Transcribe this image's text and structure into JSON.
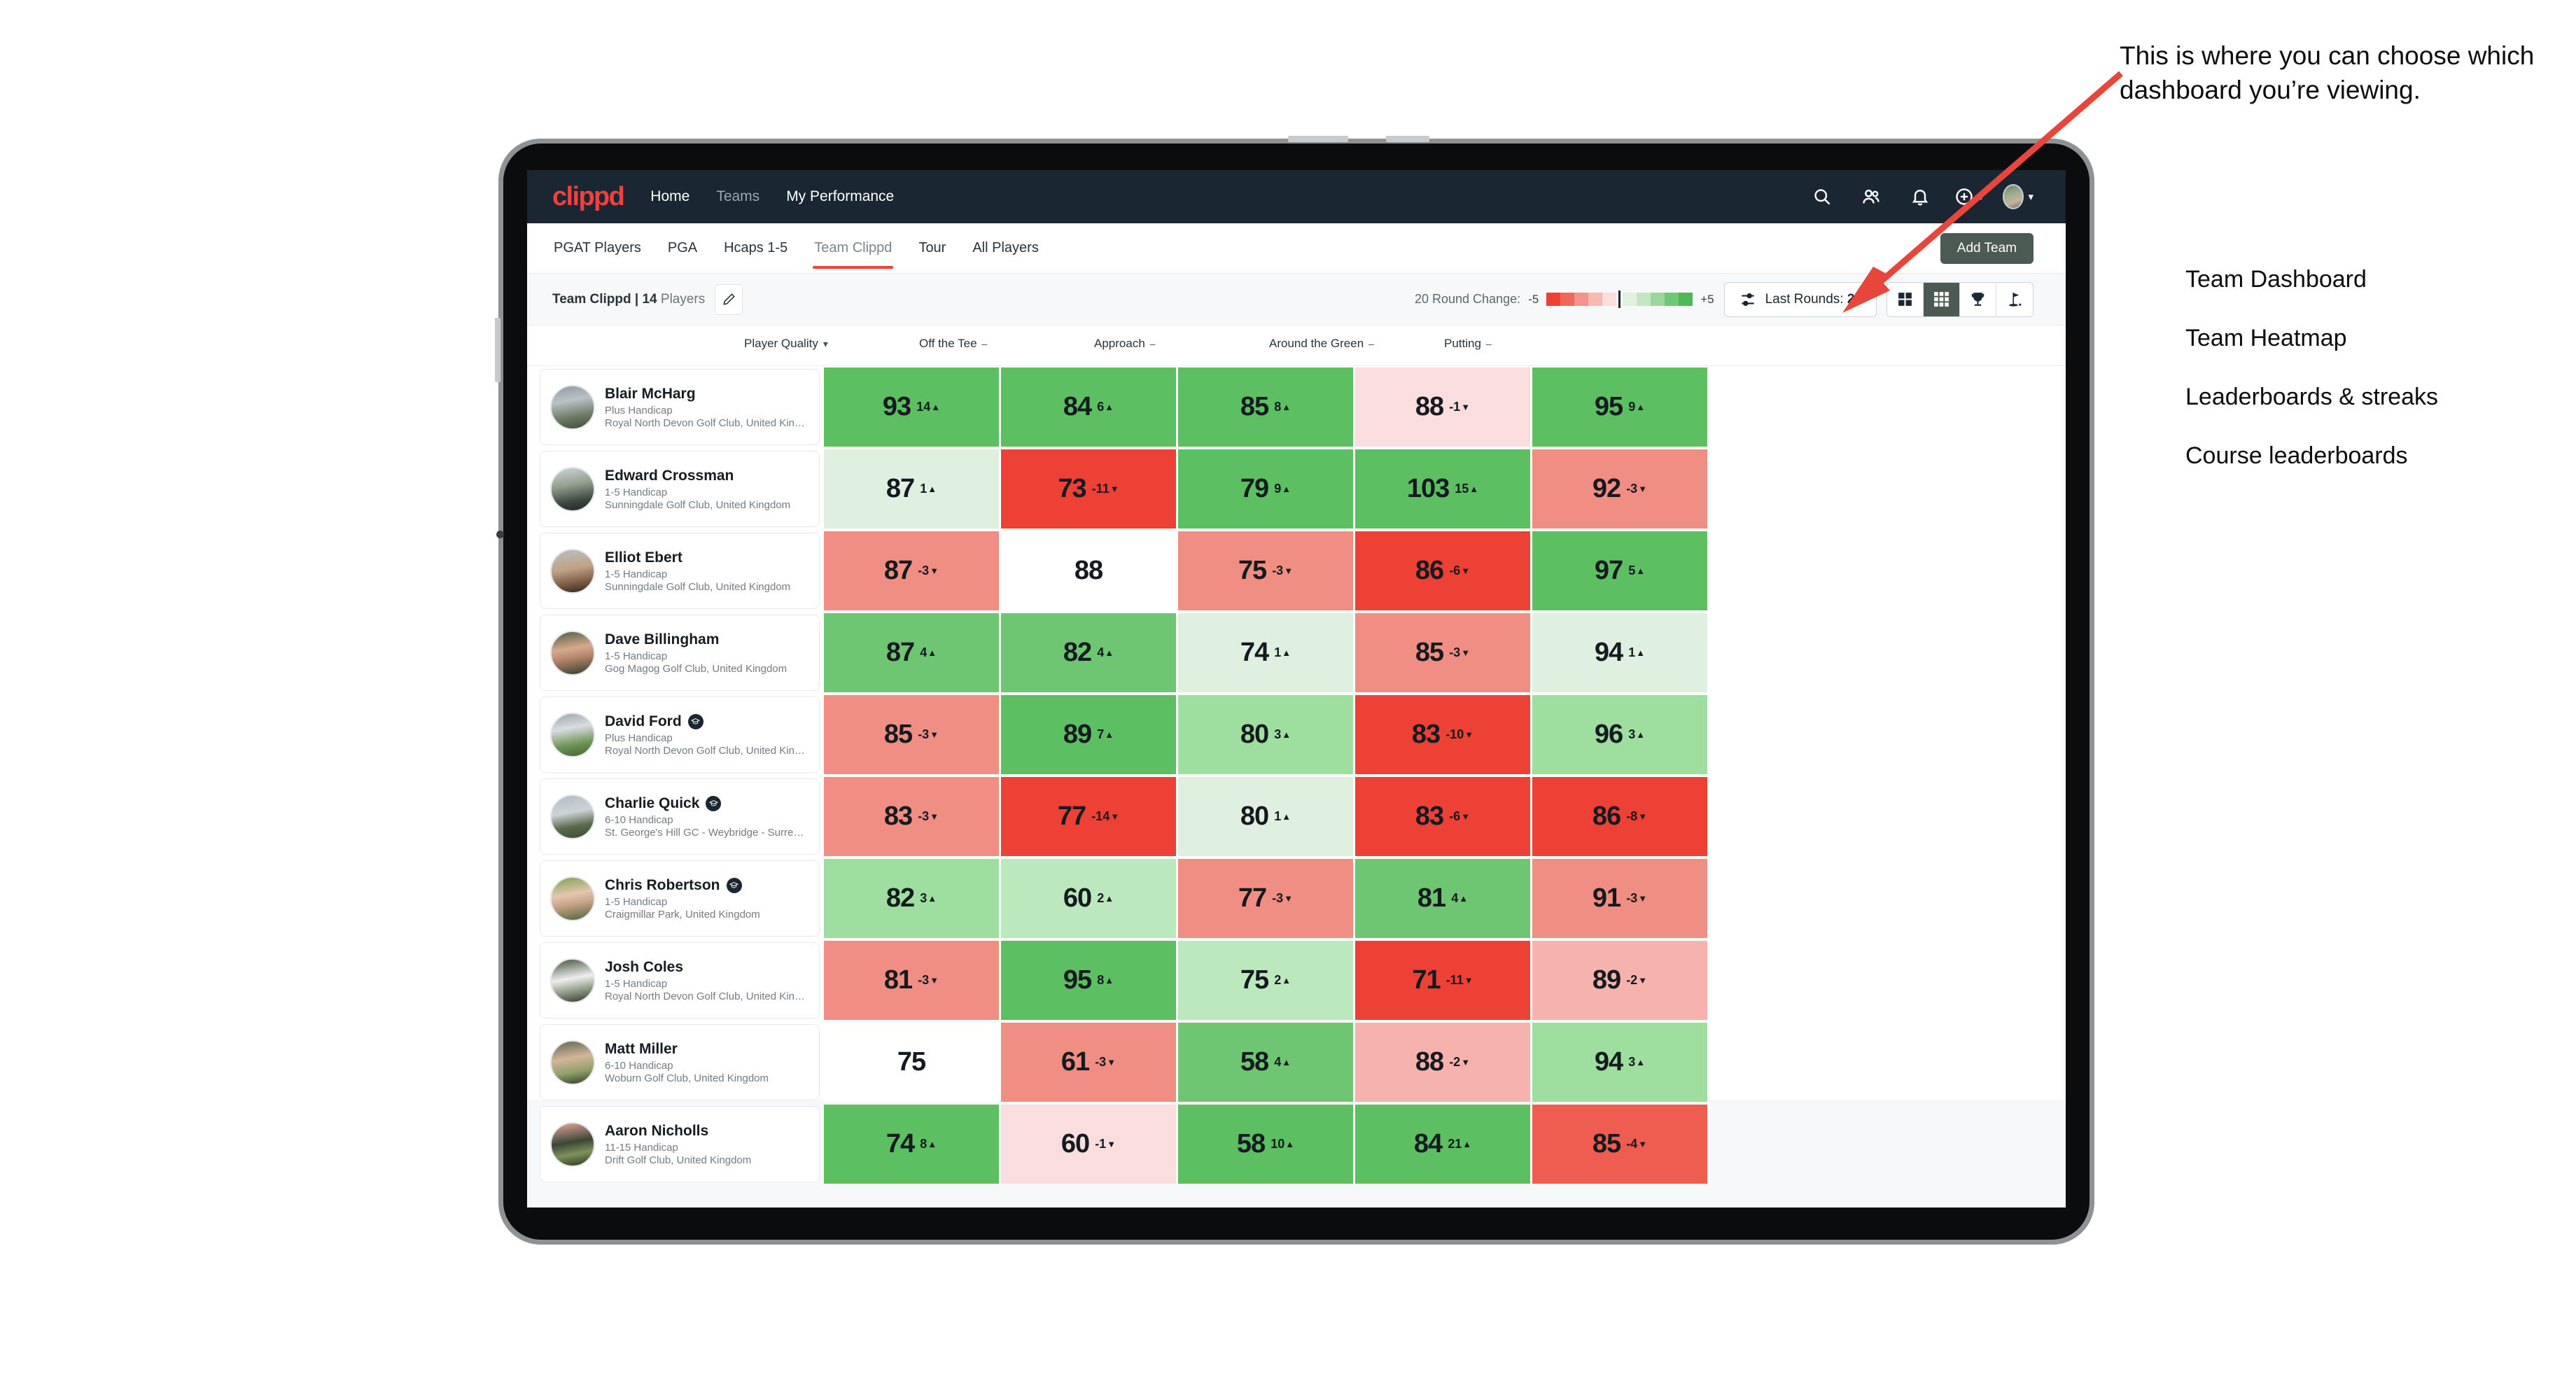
{
  "navbar": {
    "brand": "clippd",
    "links": [
      {
        "label": "Home",
        "muted": false
      },
      {
        "label": "Teams",
        "muted": true
      },
      {
        "label": "My Performance",
        "muted": false
      }
    ],
    "icons": [
      "search-icon",
      "people-icon",
      "bell-icon",
      "plus-circle-icon",
      "user-avatar"
    ]
  },
  "subtabs": {
    "items": [
      {
        "label": "PGAT Players",
        "active": false
      },
      {
        "label": "PGA",
        "active": false
      },
      {
        "label": "Hcaps 1-5",
        "active": false
      },
      {
        "label": "Team Clippd",
        "active": true
      },
      {
        "label": "Tour",
        "active": false
      },
      {
        "label": "All Players",
        "active": false
      }
    ],
    "add_team_label": "Add Team"
  },
  "toolbar": {
    "team_name": "Team Clippd",
    "separator": " | ",
    "player_count": "14",
    "players_word": " Players",
    "edit_icon": "pencil-icon",
    "round_change_label": "20 Round Change:",
    "legend_min": "-5",
    "legend_max": "+5",
    "legend_colors": [
      "#ee4136",
      "#f0675c",
      "#f4938b",
      "#f7b9b4",
      "#fbdedb",
      "#e0f1e0",
      "#c3e6c3",
      "#9bd79c",
      "#72c776",
      "#4cb857"
    ],
    "last_rounds_prefix": "Last Rounds: ",
    "last_rounds_value": "20",
    "view_toggles": [
      {
        "name": "grid-2x2-icon",
        "active": false
      },
      {
        "name": "grid-3x3-icon",
        "active": true
      },
      {
        "name": "trophy-icon",
        "active": false
      },
      {
        "name": "golf-flag-icon",
        "active": false
      }
    ]
  },
  "grid": {
    "columns": [
      {
        "label": "Player Quality",
        "mark": "▾"
      },
      {
        "label": "Off the Tee",
        "mark": "–"
      },
      {
        "label": "Approach",
        "mark": "–"
      },
      {
        "label": "Around the Green",
        "mark": "–"
      },
      {
        "label": "Putting",
        "mark": "–"
      }
    ],
    "rows": [
      {
        "name": "Blair McHarg",
        "badge": false,
        "handicap": "Plus Handicap",
        "club": "Royal North Devon Golf Club, United Kingdom",
        "avatar": "linear-gradient(170deg,#8d9aa4 0%,#b9c2c6 35%,#6b7a62 70%,#3c4a3a 100%)",
        "cells": [
          {
            "value": "93",
            "delta": "14",
            "dir": "up",
            "bg": "#5cbf62"
          },
          {
            "value": "84",
            "delta": "6",
            "dir": "up",
            "bg": "#5cbf62"
          },
          {
            "value": "85",
            "delta": "8",
            "dir": "up",
            "bg": "#5cbf62"
          },
          {
            "value": "88",
            "delta": "-1",
            "dir": "down",
            "bg": "#fadedd"
          },
          {
            "value": "95",
            "delta": "9",
            "dir": "up",
            "bg": "#5cbf62"
          }
        ]
      },
      {
        "name": "Edward Crossman",
        "badge": false,
        "handicap": "1-5 Handicap",
        "club": "Sunningdale Golf Club, United Kingdom",
        "avatar": "linear-gradient(170deg,#cfd6da 0%,#93a08e 40%,#3b4740 75%,#20272a 100%)",
        "cells": [
          {
            "value": "87",
            "delta": "1",
            "dir": "up",
            "bg": "#dff0e1"
          },
          {
            "value": "73",
            "delta": "-11",
            "dir": "down",
            "bg": "#ee4136"
          },
          {
            "value": "79",
            "delta": "9",
            "dir": "up",
            "bg": "#5cbf62"
          },
          {
            "value": "103",
            "delta": "15",
            "dir": "up",
            "bg": "#5cbf62"
          },
          {
            "value": "92",
            "delta": "-3",
            "dir": "down",
            "bg": "#f18e84"
          }
        ]
      },
      {
        "name": "Elliot Ebert",
        "badge": false,
        "handicap": "1-5 Handicap",
        "club": "Sunningdale Golf Club, United Kingdom",
        "avatar": "linear-gradient(170deg,#b9bfc2 0%,#c0a184 45%,#7a5a42 75%,#2b2420 100%)",
        "cells": [
          {
            "value": "87",
            "delta": "-3",
            "dir": "down",
            "bg": "#f18e84"
          },
          {
            "value": "88",
            "delta": "",
            "dir": "",
            "bg": "#ffffff"
          },
          {
            "value": "75",
            "delta": "-3",
            "dir": "down",
            "bg": "#f18e84"
          },
          {
            "value": "86",
            "delta": "-6",
            "dir": "down",
            "bg": "#ee4136"
          },
          {
            "value": "97",
            "delta": "5",
            "dir": "up",
            "bg": "#5cbf62"
          }
        ]
      },
      {
        "name": "Dave Billingham",
        "badge": false,
        "handicap": "1-5 Handicap",
        "club": "Gog Magog Golf Club, United Kingdom",
        "avatar": "linear-gradient(170deg,#4d5d43 0%,#d7a98c 40%,#b5866a 60%,#2f3a2c 100%)",
        "cells": [
          {
            "value": "87",
            "delta": "4",
            "dir": "up",
            "bg": "#6ec672"
          },
          {
            "value": "82",
            "delta": "4",
            "dir": "up",
            "bg": "#6ec672"
          },
          {
            "value": "74",
            "delta": "1",
            "dir": "up",
            "bg": "#dff0e1"
          },
          {
            "value": "85",
            "delta": "-3",
            "dir": "down",
            "bg": "#f18e84"
          },
          {
            "value": "94",
            "delta": "1",
            "dir": "up",
            "bg": "#dff0e1"
          }
        ]
      },
      {
        "name": "David Ford",
        "badge": true,
        "handicap": "Plus Handicap",
        "club": "Royal North Devon Golf Club, United Kingdom",
        "avatar": "linear-gradient(170deg,#9aa6ad 0%,#d8dde0 35%,#6f9455 70%,#42632f 100%)",
        "cells": [
          {
            "value": "85",
            "delta": "-3",
            "dir": "down",
            "bg": "#f18e84"
          },
          {
            "value": "89",
            "delta": "7",
            "dir": "up",
            "bg": "#5cbf62"
          },
          {
            "value": "80",
            "delta": "3",
            "dir": "up",
            "bg": "#9edfa0"
          },
          {
            "value": "83",
            "delta": "-10",
            "dir": "down",
            "bg": "#ee4136"
          },
          {
            "value": "96",
            "delta": "3",
            "dir": "up",
            "bg": "#9edfa0"
          }
        ]
      },
      {
        "name": "Charlie Quick",
        "badge": true,
        "handicap": "6-10 Handicap",
        "club": "St. George's Hill GC - Weybridge - Surrey, Uni...",
        "avatar": "linear-gradient(170deg,#b3bcc1 0%,#cdd4d7 40%,#596b4a 70%,#3c4a33 100%)",
        "cells": [
          {
            "value": "83",
            "delta": "-3",
            "dir": "down",
            "bg": "#f18e84"
          },
          {
            "value": "77",
            "delta": "-14",
            "dir": "down",
            "bg": "#ee4136"
          },
          {
            "value": "80",
            "delta": "1",
            "dir": "up",
            "bg": "#dff0e1"
          },
          {
            "value": "83",
            "delta": "-6",
            "dir": "down",
            "bg": "#ee4136"
          },
          {
            "value": "86",
            "delta": "-8",
            "dir": "down",
            "bg": "#ee4136"
          }
        ]
      },
      {
        "name": "Chris Robertson",
        "badge": true,
        "handicap": "1-5 Handicap",
        "club": "Craigmillar Park, United Kingdom",
        "avatar": "linear-gradient(170deg,#7da352 0%,#e4c6ae 40%,#c9a489 60%,#4c6436 100%)",
        "cells": [
          {
            "value": "82",
            "delta": "3",
            "dir": "up",
            "bg": "#9edfa0"
          },
          {
            "value": "60",
            "delta": "2",
            "dir": "up",
            "bg": "#bbe8bc"
          },
          {
            "value": "77",
            "delta": "-3",
            "dir": "down",
            "bg": "#f18e84"
          },
          {
            "value": "81",
            "delta": "4",
            "dir": "up",
            "bg": "#6ec672"
          },
          {
            "value": "91",
            "delta": "-3",
            "dir": "down",
            "bg": "#f18e84"
          }
        ]
      },
      {
        "name": "Josh Coles",
        "badge": false,
        "handicap": "1-5 Handicap",
        "club": "Royal North Devon Golf Club, United Kingdom",
        "avatar": "linear-gradient(170deg,#445238 0%,#edeef0 45%,#b9bfae 60%,#2d3827 100%)",
        "cells": [
          {
            "value": "81",
            "delta": "-3",
            "dir": "down",
            "bg": "#f18e84"
          },
          {
            "value": "95",
            "delta": "8",
            "dir": "up",
            "bg": "#5cbf62"
          },
          {
            "value": "75",
            "delta": "2",
            "dir": "up",
            "bg": "#bbe8bc"
          },
          {
            "value": "71",
            "delta": "-11",
            "dir": "down",
            "bg": "#ee4136"
          },
          {
            "value": "89",
            "delta": "-2",
            "dir": "down",
            "bg": "#f6b2ac"
          }
        ]
      },
      {
        "name": "Matt Miller",
        "badge": false,
        "handicap": "6-10 Handicap",
        "club": "Woburn Golf Club, United Kingdom",
        "avatar": "linear-gradient(170deg,#5b6650 0%,#d3b59a 40%,#8fa06a 70%,#2f3a2a 100%)",
        "cells": [
          {
            "value": "75",
            "delta": "",
            "dir": "",
            "bg": "#ffffff"
          },
          {
            "value": "61",
            "delta": "-3",
            "dir": "down",
            "bg": "#f18e84"
          },
          {
            "value": "58",
            "delta": "4",
            "dir": "up",
            "bg": "#6ec672"
          },
          {
            "value": "88",
            "delta": "-2",
            "dir": "down",
            "bg": "#f6b2ac"
          },
          {
            "value": "94",
            "delta": "3",
            "dir": "up",
            "bg": "#9edfa0"
          }
        ]
      },
      {
        "name": "Aaron Nicholls",
        "badge": false,
        "handicap": "11-15 Handicap",
        "club": "Drift Golf Club, United Kingdom",
        "avatar": "linear-gradient(170deg,#e9a79c 0%,#3b4637 45%,#7e9159 70%,#2b3526 100%)",
        "cells": [
          {
            "value": "74",
            "delta": "8",
            "dir": "up",
            "bg": "#5cbf62"
          },
          {
            "value": "60",
            "delta": "-1",
            "dir": "down",
            "bg": "#fadedd"
          },
          {
            "value": "58",
            "delta": "10",
            "dir": "up",
            "bg": "#5cbf62"
          },
          {
            "value": "84",
            "delta": "21",
            "dir": "up",
            "bg": "#5cbf62"
          },
          {
            "value": "85",
            "delta": "-4",
            "dir": "down",
            "bg": "#ef5d51"
          }
        ]
      }
    ]
  },
  "annotations": {
    "paragraph": "This is where you can choose which dashboard you’re viewing.",
    "options": [
      "Team Dashboard",
      "Team Heatmap",
      "Leaderboards & streaks",
      "Course leaderboards"
    ],
    "arrow_color": "#e8463a"
  }
}
